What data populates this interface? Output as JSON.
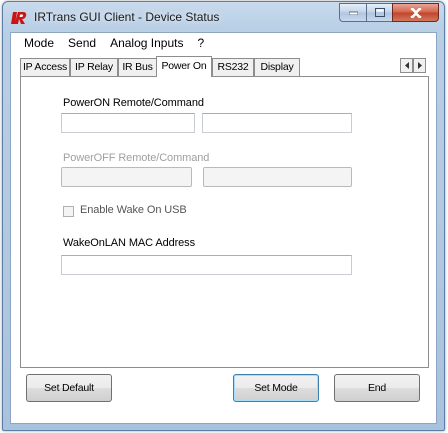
{
  "window": {
    "title": "IRTrans GUI Client - Device Status",
    "icon": "irtrans-logo-icon",
    "controls": [
      "minimize-icon",
      "maximize-icon",
      "close-icon"
    ]
  },
  "menu": {
    "items": [
      "Mode",
      "Send",
      "Analog Inputs",
      "?"
    ]
  },
  "tabs": {
    "items": [
      "IP Access",
      "IP Relay",
      "IR Bus",
      "Power On",
      "RS232",
      "Display"
    ],
    "active": "Power On"
  },
  "power_on": {
    "on_label": "PowerON Remote/Command",
    "on_remote_value": "",
    "on_command_value": "",
    "off_label": "PowerOFF Remote/Command",
    "off_remote_value": "",
    "off_command_value": "",
    "wake_usb_label": "Enable Wake On USB",
    "wake_usb_checked": false,
    "mac_label": "WakeOnLAN MAC Address",
    "mac_value": ""
  },
  "buttons": {
    "set_default": "Set Default",
    "set_mode": "Set Mode",
    "end": "End"
  }
}
